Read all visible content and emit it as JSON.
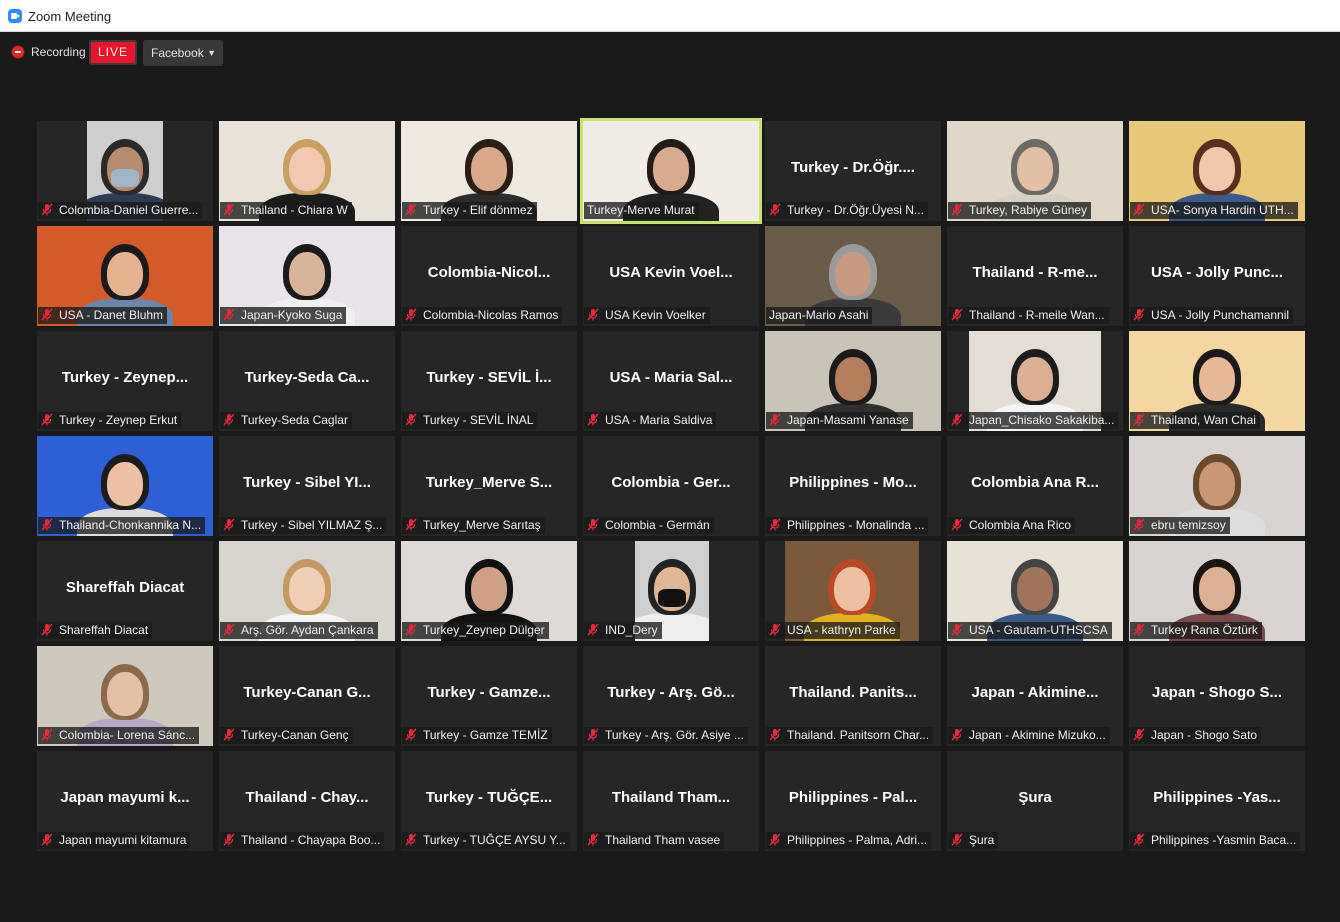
{
  "window": {
    "title": "Zoom Meeting"
  },
  "toolbar": {
    "recording_label": "Recording",
    "live_label": "LIVE",
    "destination_label": "Facebook"
  },
  "colors": {
    "live_red": "#e8142b",
    "active_speaker": "#c6e36b",
    "mute_icon": "#e8283c",
    "recording_dot": "#e02828"
  },
  "active_speaker": "Turkey-Merve Murat",
  "participants": [
    {
      "label": "Colombia-Daniel Guerre...",
      "muted": true,
      "video": true
    },
    {
      "label": "Thailand - Chiara W",
      "muted": true,
      "video": true
    },
    {
      "label": "Turkey - Elif dönmez",
      "muted": true,
      "video": true
    },
    {
      "label": "Turkey-Merve Murat",
      "muted": false,
      "video": true
    },
    {
      "label": "Turkey - Dr.Öğr.Üyesi N...",
      "display_name": "Turkey - Dr.Öğr....",
      "muted": true,
      "video": false
    },
    {
      "label": "Turkey, Rabiye Güney",
      "muted": true,
      "video": true
    },
    {
      "label": "USA- Sonya Hardin UTH...",
      "muted": true,
      "video": true
    },
    {
      "label": "USA - Danet Bluhm",
      "muted": true,
      "video": true
    },
    {
      "label": "Japan-Kyoko Suga",
      "muted": true,
      "video": true
    },
    {
      "label": "Colombia-Nicolas Ramos",
      "display_name": "Colombia-Nicol...",
      "muted": true,
      "video": false
    },
    {
      "label": "USA Kevin Voelker",
      "display_name": "USA Kevin Voel...",
      "muted": true,
      "video": false
    },
    {
      "label": "Japan-Mario Asahi",
      "muted": false,
      "video": true
    },
    {
      "label": "Thailand - R-meile Wan...",
      "display_name": "Thailand - R-me...",
      "muted": true,
      "video": false
    },
    {
      "label": "USA - Jolly Punchamannil",
      "display_name": "USA - Jolly Punc...",
      "muted": true,
      "video": false
    },
    {
      "label": "Turkey - Zeynep Erkut",
      "display_name": "Turkey - Zeynep...",
      "muted": true,
      "video": false
    },
    {
      "label": "Turkey-Seda Caglar",
      "display_name": "Turkey-Seda Ca...",
      "muted": true,
      "video": false
    },
    {
      "label": "Turkey - SEVİL İNAL",
      "display_name": "Turkey - SEVİL İ...",
      "muted": true,
      "video": false
    },
    {
      "label": "USA - Maria Saldiva",
      "display_name": "USA - Maria Sal...",
      "muted": true,
      "video": false
    },
    {
      "label": "Japan-Masami Yanase",
      "muted": true,
      "video": true
    },
    {
      "label": "Japan_Chisako Sakakiba...",
      "muted": true,
      "video": true
    },
    {
      "label": "Thailand, Wan Chai",
      "muted": true,
      "video": true
    },
    {
      "label": "Thailand-Chonkannika N...",
      "muted": true,
      "video": true
    },
    {
      "label": "Turkey - Sibel YILMAZ Ş...",
      "display_name": "Turkey - Sibel YI...",
      "muted": true,
      "video": false
    },
    {
      "label": "Turkey_Merve Sarıtaş",
      "display_name": "Turkey_Merve S...",
      "muted": true,
      "video": false
    },
    {
      "label": "Colombia - Germán",
      "display_name": "Colombia - Ger...",
      "muted": true,
      "video": false
    },
    {
      "label": "Philippines - Monalinda ...",
      "display_name": "Philippines - Mo...",
      "muted": true,
      "video": false
    },
    {
      "label": "Colombia Ana Rico",
      "display_name": "Colombia Ana R...",
      "muted": true,
      "video": false
    },
    {
      "label": "ebru temizsoy",
      "muted": true,
      "video": true
    },
    {
      "label": "Shareffah Diacat",
      "display_name": "Shareffah Diacat",
      "muted": true,
      "video": false
    },
    {
      "label": "Arş. Gör. Aydan Çankara",
      "muted": true,
      "video": true
    },
    {
      "label": "Turkey_Zeynep Dülger",
      "muted": true,
      "video": true
    },
    {
      "label": "IND_Dery",
      "muted": true,
      "video": true
    },
    {
      "label": "USA - kathryn Parke",
      "muted": true,
      "video": true
    },
    {
      "label": "USA - Gautam-UTHSCSA",
      "muted": true,
      "video": true
    },
    {
      "label": "Turkey Rana Öztürk",
      "muted": true,
      "video": true
    },
    {
      "label": "Colombia- Lorena Sánc...",
      "muted": true,
      "video": true
    },
    {
      "label": "Turkey-Canan Genç",
      "display_name": "Turkey-Canan G...",
      "muted": true,
      "video": false
    },
    {
      "label": "Turkey - Gamze TEMİZ",
      "display_name": "Turkey - Gamze...",
      "muted": true,
      "video": false
    },
    {
      "label": "Turkey - Arş. Gör. Asiye ...",
      "display_name": "Turkey - Arş. Gö...",
      "muted": true,
      "video": false
    },
    {
      "label": "Thailand. Panitsorn Char...",
      "display_name": "Thailand. Panits...",
      "muted": true,
      "video": false
    },
    {
      "label": "Japan - Akimine Mizuko...",
      "display_name": "Japan - Akimine...",
      "muted": true,
      "video": false
    },
    {
      "label": "Japan - Shogo Sato",
      "display_name": "Japan - Shogo S...",
      "muted": true,
      "video": false
    },
    {
      "label": "Japan mayumi kitamura",
      "display_name": "Japan mayumi k...",
      "muted": true,
      "video": false
    },
    {
      "label": "Thailand - Chayapa Boo...",
      "display_name": "Thailand - Chay...",
      "muted": true,
      "video": false
    },
    {
      "label": "Turkey - TUĞÇE AYSU Y...",
      "display_name": "Turkey - TUĞÇE...",
      "muted": true,
      "video": false
    },
    {
      "label": "Thailand Tham vasee",
      "display_name": "Thailand Tham...",
      "muted": true,
      "video": false
    },
    {
      "label": "Philippines - Palma, Adri...",
      "display_name": "Philippines - Pal...",
      "muted": true,
      "video": false
    },
    {
      "label": "Şura",
      "display_name": "Şura",
      "muted": true,
      "video": false
    },
    {
      "label": "Philippines -Yasmin Baca...",
      "display_name": "Philippines -Yas...",
      "muted": true,
      "video": false
    }
  ]
}
